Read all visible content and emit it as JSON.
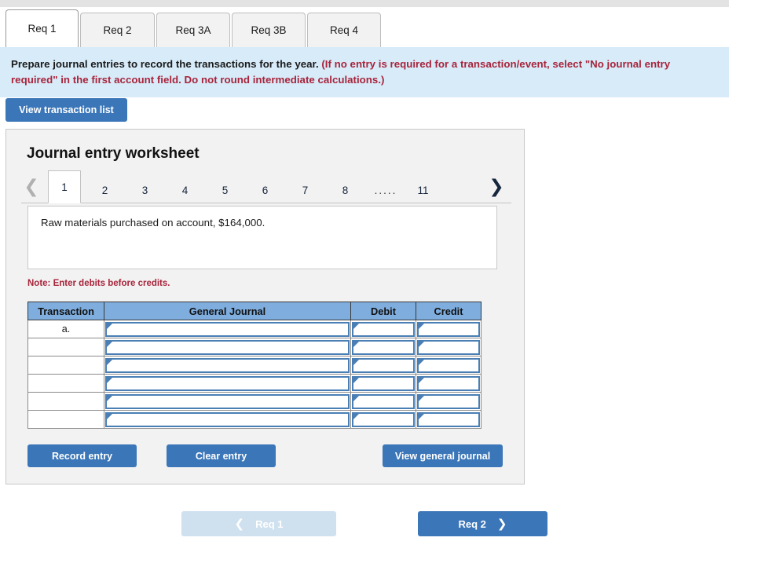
{
  "tabs": [
    {
      "label": "Req 1",
      "active": true
    },
    {
      "label": "Req 2",
      "active": false
    },
    {
      "label": "Req 3A",
      "active": false
    },
    {
      "label": "Req 3B",
      "active": false
    },
    {
      "label": "Req 4",
      "active": false
    }
  ],
  "instructions": {
    "main": "Prepare journal entries to record the transactions for the year.",
    "hint": "(If no entry is required for a transaction/event, select \"No journal entry required\" in the first account field. Do not round intermediate calculations.)"
  },
  "toolbar": {
    "view_transaction_list": "View transaction list"
  },
  "worksheet": {
    "title": "Journal entry worksheet",
    "pager": {
      "prev_icon": "❮",
      "next_icon": "❯",
      "pages": [
        "1",
        "2",
        "3",
        "4",
        "5",
        "6",
        "7",
        "8"
      ],
      "ellipsis": ".....",
      "last_page": "11",
      "active_page": "1"
    },
    "transaction_text": "Raw materials purchased on account, $164,000.",
    "note": "Note: Enter debits before credits.",
    "table": {
      "headers": [
        "Transaction",
        "General Journal",
        "Debit",
        "Credit"
      ],
      "rows": [
        {
          "transaction": "a.",
          "general_journal": "",
          "debit": "",
          "credit": ""
        },
        {
          "transaction": "",
          "general_journal": "",
          "debit": "",
          "credit": ""
        },
        {
          "transaction": "",
          "general_journal": "",
          "debit": "",
          "credit": ""
        },
        {
          "transaction": "",
          "general_journal": "",
          "debit": "",
          "credit": ""
        },
        {
          "transaction": "",
          "general_journal": "",
          "debit": "",
          "credit": ""
        },
        {
          "transaction": "",
          "general_journal": "",
          "debit": "",
          "credit": ""
        }
      ]
    },
    "actions": {
      "record_entry": "Record entry",
      "clear_entry": "Clear entry",
      "view_general_journal": "View general journal"
    }
  },
  "footer": {
    "prev_label": "Req 1",
    "prev_icon": "❮",
    "next_label": "Req 2",
    "next_icon": "❯"
  },
  "colors": {
    "accent_blue": "#3b76b8",
    "disabled_blue": "#cfe0ef",
    "banner_blue": "#d7ebf9",
    "table_header_blue": "#7eadde",
    "input_border_blue": "#4a7fb5",
    "warning_red": "#a8243b",
    "panel_gray": "#f2f2f2"
  }
}
